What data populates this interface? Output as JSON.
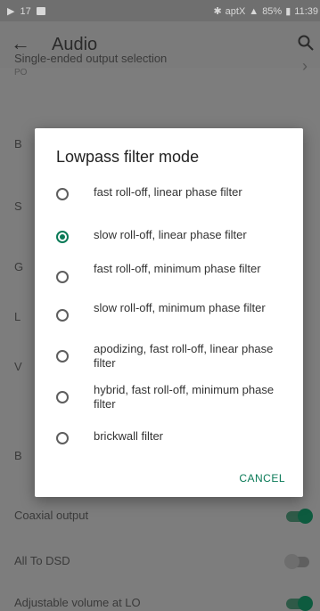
{
  "status_bar": {
    "left_text": "17",
    "right_text": "aptX",
    "battery": "85%",
    "time": "11:39"
  },
  "app_bar": {
    "title": "Audio",
    "back_icon": "arrow-left-icon",
    "search_icon": "search-icon"
  },
  "settings": {
    "single_ended": {
      "title": "Single-ended output selection",
      "subtitle": "PO"
    },
    "partial_letters": [
      "B",
      "S",
      "G",
      "L",
      "V",
      "B"
    ],
    "coaxial_output": {
      "title": "Coaxial output",
      "enabled": true
    },
    "all_to_dsd": {
      "title": "All To DSD",
      "enabled": false
    },
    "adjustable_volume": {
      "title": "Adjustable volume at LO",
      "enabled": true
    }
  },
  "dialog": {
    "title": "Lowpass filter mode",
    "options": [
      {
        "label": "fast roll-off, linear phase filter",
        "selected": false
      },
      {
        "label": "slow roll-off, linear phase filter",
        "selected": true
      },
      {
        "label": "fast roll-off, minimum phase filter",
        "selected": false
      },
      {
        "label": "slow roll-off, minimum phase filter",
        "selected": false
      },
      {
        "label": "apodizing, fast roll-off, linear phase filter",
        "selected": false
      },
      {
        "label": "hybrid, fast roll-off, minimum phase filter",
        "selected": false
      },
      {
        "label": "brickwall filter",
        "selected": false
      }
    ],
    "cancel_label": "CANCEL"
  },
  "colors": {
    "accent": "#0a7a57",
    "scrim": "#7d7d7d"
  }
}
